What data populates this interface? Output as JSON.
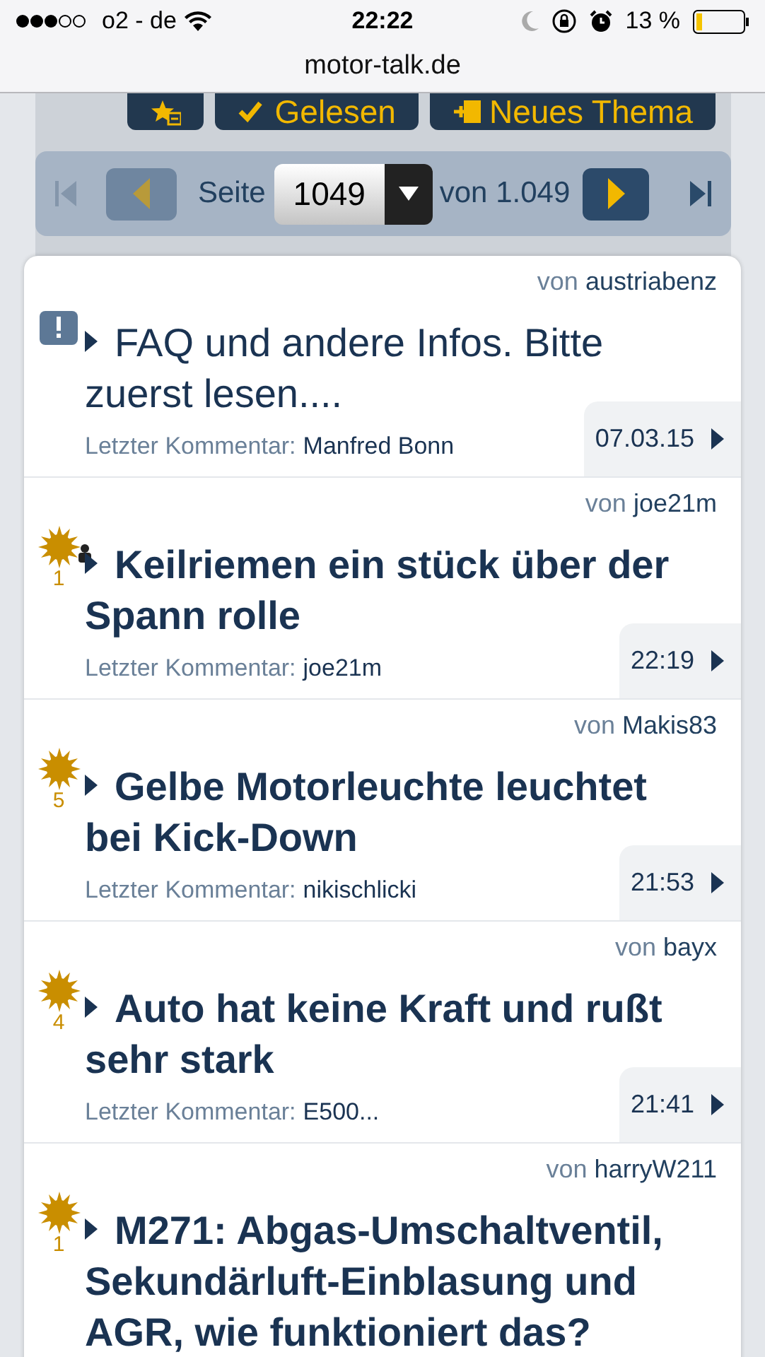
{
  "status_bar": {
    "carrier": "o2 - de",
    "time": "22:22",
    "battery": "13 %"
  },
  "address_bar": {
    "url": "motor-talk.de"
  },
  "toolbar": {
    "buttons": [
      {
        "kind": "favorite"
      },
      {
        "kind": "read",
        "label": "Gelesen"
      },
      {
        "kind": "new",
        "label": "Neues Thema"
      }
    ]
  },
  "pagination": {
    "label": "Seite",
    "page": "1049",
    "total": "von 1.049",
    "prev_disabled": true,
    "next_disabled": false
  },
  "threads": [
    {
      "kind": "announcement",
      "author_prefix": "von",
      "author": "austriabenz",
      "title": "FAQ und andere Infos. Bitte zuerst lesen....",
      "unread": false,
      "participated": false,
      "comment_label": "Letzter Kommentar:",
      "commenter": "Manfred Bonn",
      "date": "07.03.15"
    },
    {
      "kind": "hot",
      "count": "1",
      "author_prefix": "von",
      "author": "joe21m",
      "title": "Keilriemen ein stück über der Spann rolle",
      "unread": true,
      "participated": true,
      "comment_label": "Letzter Kommentar:",
      "commenter": "joe21m",
      "date": "22:19"
    },
    {
      "kind": "hot",
      "count": "5",
      "author_prefix": "von",
      "author": "Makis83",
      "title": "Gelbe Motorleuchte leuchtet bei Kick-Down",
      "unread": true,
      "participated": false,
      "comment_label": "Letzter Kommentar:",
      "commenter": "nikischlicki",
      "date": "21:53"
    },
    {
      "kind": "hot",
      "count": "4",
      "author_prefix": "von",
      "author": "bayx",
      "title": "Auto hat keine Kraft und rußt sehr stark",
      "unread": true,
      "participated": false,
      "comment_label": "Letzter Kommentar:",
      "commenter": "E500...",
      "date": "21:41"
    },
    {
      "kind": "hot",
      "count": "1",
      "author_prefix": "von",
      "author": "harryW211",
      "title": "M271: Abgas-Umschaltventil, Sekundärluft-Einblasung und AGR, wie funktioniert das?",
      "unread": true,
      "participated": false
    }
  ]
}
